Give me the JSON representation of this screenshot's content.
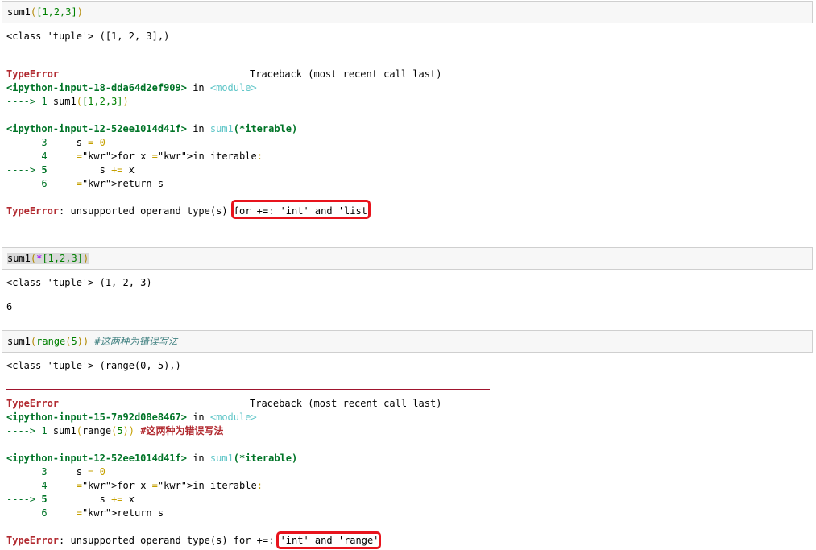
{
  "colors": {
    "error_red": "#b22b31",
    "traceback_green": "#007427",
    "module_cyan": "#60c6c8",
    "highlight_red": "#e8141d",
    "rule_red": "#a0152e",
    "input_bg": "#f7f7f7"
  },
  "cell1": {
    "input": {
      "fn": "sum1",
      "open": "(",
      "arg": "[1,2,3]",
      "close": ")"
    },
    "output": "<class 'tuple'> ([1, 2, 3],)",
    "error": {
      "type": "TypeError",
      "traceback_header": "Traceback (most recent call last)",
      "frame1": {
        "file": "<ipython-input-18-dda64d2ef909>",
        "in": " in ",
        "where": "<module>",
        "arrow": "----> ",
        "lineno": "1",
        "code_fn": " sum1",
        "code_open": "(",
        "code_arg": "[1,2,3]",
        "code_close": ")"
      },
      "frame2": {
        "file": "<ipython-input-12-52ee1014d41f>",
        "in": " in ",
        "where": "sum1",
        "sig": "(*iterable)",
        "lines": [
          {
            "prefix": "      ",
            "no": "3",
            "code": "     s = 0"
          },
          {
            "prefix": "      ",
            "no": "4",
            "code": "     for x in iterable:"
          },
          {
            "prefix": "----> ",
            "no": "5",
            "code": "         s += x"
          },
          {
            "prefix": "      ",
            "no": "6",
            "code": "     return s"
          }
        ]
      },
      "message_pre": ": unsupported operand type(s) ",
      "message_highlight": "for +=: 'int' and 'list'"
    }
  },
  "cell2": {
    "input": {
      "fn": "sum1",
      "open": "(",
      "star": "*",
      "arg": "[1,2,3]",
      "close": ")"
    },
    "output1": "<class 'tuple'> (1, 2, 3)",
    "output2": "6"
  },
  "cell3": {
    "input": {
      "fn": "sum1",
      "open": "(",
      "inner_fn": "range",
      "inner_open": "(",
      "inner_arg": "5",
      "inner_close": ")",
      "close": ")",
      "comment": " #这两种为错误写法"
    },
    "output": "<class 'tuple'> (range(0, 5),)",
    "error": {
      "type": "TypeError",
      "traceback_header": "Traceback (most recent call last)",
      "frame1": {
        "file": "<ipython-input-15-7a92d08e8467>",
        "in": " in ",
        "where": "<module>",
        "arrow": "----> ",
        "lineno": "1",
        "code_fn": " sum1",
        "code_open": "(",
        "code_inner": "range",
        "code_inner_open": "(",
        "code_inner_arg": "5",
        "code_inner_close": ")",
        "code_close": ")",
        "code_comment": " #这两种为错误写法"
      },
      "frame2": {
        "file": "<ipython-input-12-52ee1014d41f>",
        "in": " in ",
        "where": "sum1",
        "sig": "(*iterable)",
        "lines": [
          {
            "prefix": "      ",
            "no": "3",
            "code": "     s = 0"
          },
          {
            "prefix": "      ",
            "no": "4",
            "code": "     for x in iterable:"
          },
          {
            "prefix": "----> ",
            "no": "5",
            "code": "         s += x"
          },
          {
            "prefix": "      ",
            "no": "6",
            "code": "     return s"
          }
        ]
      },
      "message_pre": ": unsupported operand type(s) for +=: ",
      "message_highlight": "'int' and 'range'"
    }
  }
}
